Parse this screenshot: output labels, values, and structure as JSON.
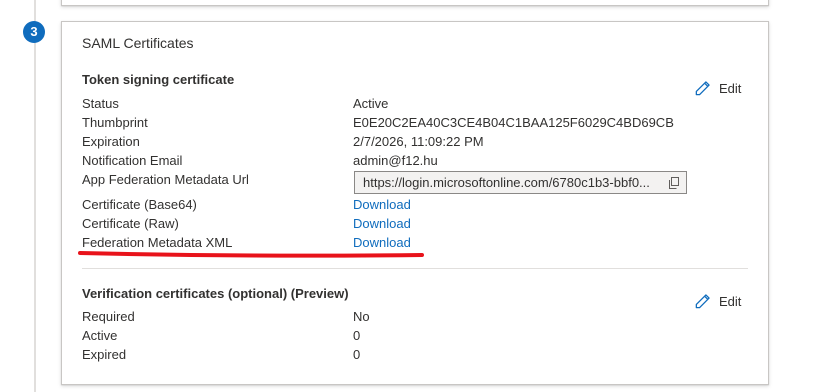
{
  "step": {
    "number": "3"
  },
  "card": {
    "title": "SAML Certificates"
  },
  "token_section": {
    "title": "Token signing certificate",
    "edit_label": "Edit",
    "rows": [
      {
        "label": "Status",
        "value": "Active"
      },
      {
        "label": "Thumbprint",
        "value": "E0E20C2EA40C3CE4B04C1BAA125F6029C4BD69CB"
      },
      {
        "label": "Expiration",
        "value": "2/7/2026, 11:09:22 PM"
      },
      {
        "label": "Notification Email",
        "value": "admin@f12.hu"
      },
      {
        "label": "App Federation Metadata Url",
        "value": "https://login.microsoftonline.com/6780c1b3-bbf0..."
      },
      {
        "label": "Certificate (Base64)",
        "value": "Download"
      },
      {
        "label": "Certificate (Raw)",
        "value": "Download"
      },
      {
        "label": "Federation Metadata XML",
        "value": "Download"
      }
    ]
  },
  "verification_section": {
    "title": "Verification certificates (optional) (Preview)",
    "edit_label": "Edit",
    "rows": [
      {
        "label": "Required",
        "value": "No"
      },
      {
        "label": "Active",
        "value": "0"
      },
      {
        "label": "Expired",
        "value": "0"
      }
    ]
  },
  "colors": {
    "accent": "#0f6cbd",
    "annotation": "#e8131b",
    "border": "#c8c6c4"
  }
}
